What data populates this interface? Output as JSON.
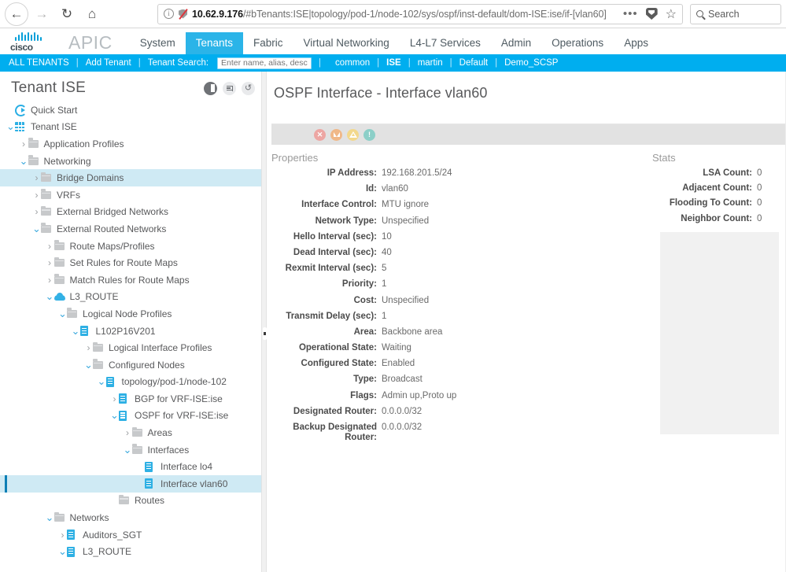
{
  "browser": {
    "back_icon": "arrow-left-icon",
    "forward_icon": "arrow-right-icon",
    "reload_icon": "reload-icon",
    "home_icon": "home-icon",
    "info_glyph": "i",
    "url_host": "10.62.9.176",
    "url_path": "/#bTenants:ISE|topology/pod-1/node-102/sys/ospf/inst-default/dom-ISE:ise/if-[vlan60]",
    "menu_dots": "•••",
    "pocket_icon": "pocket-icon",
    "star_icon": "☆",
    "search_placeholder": "Search"
  },
  "app": {
    "brand": "cisco",
    "product": "APIC",
    "nav": [
      {
        "label": "System",
        "active": false
      },
      {
        "label": "Tenants",
        "active": true
      },
      {
        "label": "Fabric",
        "active": false
      },
      {
        "label": "Virtual Networking",
        "active": false
      },
      {
        "label": "L4-L7 Services",
        "active": false
      },
      {
        "label": "Admin",
        "active": false
      },
      {
        "label": "Operations",
        "active": false
      },
      {
        "label": "Apps",
        "active": false
      }
    ]
  },
  "tenant_bar": {
    "all_tenants": "ALL TENANTS",
    "add_tenant": "Add Tenant",
    "search_label": "Tenant Search:",
    "search_placeholder": "Enter name, alias, descr",
    "search_value": "",
    "tenants": [
      {
        "label": "common",
        "bold": false
      },
      {
        "label": "ISE",
        "bold": true
      },
      {
        "label": "martin",
        "bold": false
      },
      {
        "label": "Default",
        "bold": false
      },
      {
        "label": "Demo_SCSP",
        "bold": false
      }
    ],
    "separator": "|"
  },
  "sidebar": {
    "title": "Tenant ISE",
    "tools": [
      {
        "name": "quick-start-toggle-icon"
      },
      {
        "name": "collapse-all-icon"
      },
      {
        "name": "refresh-icon",
        "glyph": "↺"
      }
    ],
    "tree": [
      {
        "label": "Quick Start",
        "depth": 0,
        "caret": "none",
        "icon": "quick-start-icon",
        "state": ""
      },
      {
        "label": "Tenant ISE",
        "depth": 0,
        "caret": "open",
        "icon": "grid-icon",
        "state": ""
      },
      {
        "label": "Application Profiles",
        "depth": 1,
        "caret": "closed",
        "icon": "folder-icon",
        "state": ""
      },
      {
        "label": "Networking",
        "depth": 1,
        "caret": "open",
        "icon": "folder-icon",
        "state": ""
      },
      {
        "label": "Bridge Domains",
        "depth": 2,
        "caret": "closed",
        "icon": "folder-icon",
        "state": "hl"
      },
      {
        "label": "VRFs",
        "depth": 2,
        "caret": "closed",
        "icon": "folder-icon",
        "state": ""
      },
      {
        "label": "External Bridged Networks",
        "depth": 2,
        "caret": "closed",
        "icon": "folder-icon",
        "state": ""
      },
      {
        "label": "External Routed Networks",
        "depth": 2,
        "caret": "open",
        "icon": "folder-icon",
        "state": ""
      },
      {
        "label": "Route Maps/Profiles",
        "depth": 3,
        "caret": "closed",
        "icon": "folder-icon",
        "state": ""
      },
      {
        "label": "Set Rules for Route Maps",
        "depth": 3,
        "caret": "closed",
        "icon": "folder-icon",
        "state": ""
      },
      {
        "label": "Match Rules for Route Maps",
        "depth": 3,
        "caret": "closed",
        "icon": "folder-icon",
        "state": ""
      },
      {
        "label": "L3_ROUTE",
        "depth": 3,
        "caret": "open",
        "icon": "cloud-icon",
        "state": ""
      },
      {
        "label": "Logical Node Profiles",
        "depth": 4,
        "caret": "open",
        "icon": "folder-icon",
        "state": ""
      },
      {
        "label": "L102P16V201",
        "depth": 5,
        "caret": "open",
        "icon": "doc-icon",
        "state": ""
      },
      {
        "label": "Logical Interface Profiles",
        "depth": 6,
        "caret": "closed",
        "icon": "folder-icon",
        "state": ""
      },
      {
        "label": "Configured Nodes",
        "depth": 6,
        "caret": "open",
        "icon": "folder-icon",
        "state": ""
      },
      {
        "label": "topology/pod-1/node-102",
        "depth": 7,
        "caret": "open",
        "icon": "doc-icon",
        "state": ""
      },
      {
        "label": "BGP for VRF-ISE:ise",
        "depth": 8,
        "caret": "closed",
        "icon": "doc-icon",
        "state": ""
      },
      {
        "label": "OSPF for VRF-ISE:ise",
        "depth": 8,
        "caret": "open",
        "icon": "doc-icon",
        "state": ""
      },
      {
        "label": "Areas",
        "depth": 9,
        "caret": "closed",
        "icon": "folder-icon",
        "state": ""
      },
      {
        "label": "Interfaces",
        "depth": 9,
        "caret": "open",
        "icon": "folder-icon",
        "state": ""
      },
      {
        "label": "Interface lo4",
        "depth": 10,
        "caret": "none",
        "icon": "doc-icon",
        "state": ""
      },
      {
        "label": "Interface vlan60",
        "depth": 10,
        "caret": "none",
        "icon": "doc-icon",
        "state": "sel"
      },
      {
        "label": "Routes",
        "depth": 8,
        "caret": "none",
        "icon": "folder-icon",
        "state": ""
      },
      {
        "label": "Networks",
        "depth": 3,
        "caret": "open",
        "icon": "folder-icon",
        "state": ""
      },
      {
        "label": "Auditors_SGT",
        "depth": 4,
        "caret": "closed",
        "icon": "doc-icon",
        "state": ""
      },
      {
        "label": "L3_ROUTE",
        "depth": 4,
        "caret": "open",
        "icon": "doc-icon",
        "state": ""
      }
    ]
  },
  "main": {
    "title": "OSPF Interface - Interface vlan60",
    "status_icons": [
      {
        "name": "critical-alert-icon",
        "kind": "critical",
        "glyph": "✕"
      },
      {
        "name": "major-alert-icon",
        "kind": "major",
        "glyph": ""
      },
      {
        "name": "minor-alert-icon",
        "kind": "minor",
        "glyph": ""
      },
      {
        "name": "info-alert-icon",
        "kind": "info",
        "glyph": "!"
      }
    ],
    "properties_heading": "Properties",
    "properties": [
      {
        "label": "IP Address:",
        "value": "192.168.201.5/24"
      },
      {
        "label": "Id:",
        "value": "vlan60"
      },
      {
        "label": "Interface Control:",
        "value": "MTU ignore"
      },
      {
        "label": "Network Type:",
        "value": "Unspecified"
      },
      {
        "label": "Hello Interval (sec):",
        "value": "10"
      },
      {
        "label": "Dead Interval (sec):",
        "value": "40"
      },
      {
        "label": "Rexmit Interval (sec):",
        "value": "5"
      },
      {
        "label": "Priority:",
        "value": "1"
      },
      {
        "label": "Cost:",
        "value": "Unspecified"
      },
      {
        "label": "Transmit Delay (sec):",
        "value": "1"
      },
      {
        "label": "Area:",
        "value": "Backbone area"
      },
      {
        "label": "Operational State:",
        "value": "Waiting"
      },
      {
        "label": "Configured State:",
        "value": "Enabled"
      },
      {
        "label": "Type:",
        "value": "Broadcast"
      },
      {
        "label": "Flags:",
        "value": "Admin up,Proto up"
      },
      {
        "label": "Designated Router:",
        "value": "0.0.0.0/32"
      },
      {
        "label": "Backup Designated Router:",
        "value": "0.0.0.0/32"
      }
    ],
    "stats_heading": "Stats",
    "stats": [
      {
        "label": "LSA Count:",
        "value": "0"
      },
      {
        "label": "Adjacent Count:",
        "value": "0"
      },
      {
        "label": "Flooding To Count:",
        "value": "0"
      },
      {
        "label": "Neighbor Count:",
        "value": "0"
      }
    ]
  },
  "colors": {
    "brand_blue": "#00aeef",
    "active_tab": "#2bb4e8",
    "tree_highlight": "#cfeaf4",
    "selection_bar": "#0c7fb5",
    "status_strip": "#e2e2e2"
  }
}
